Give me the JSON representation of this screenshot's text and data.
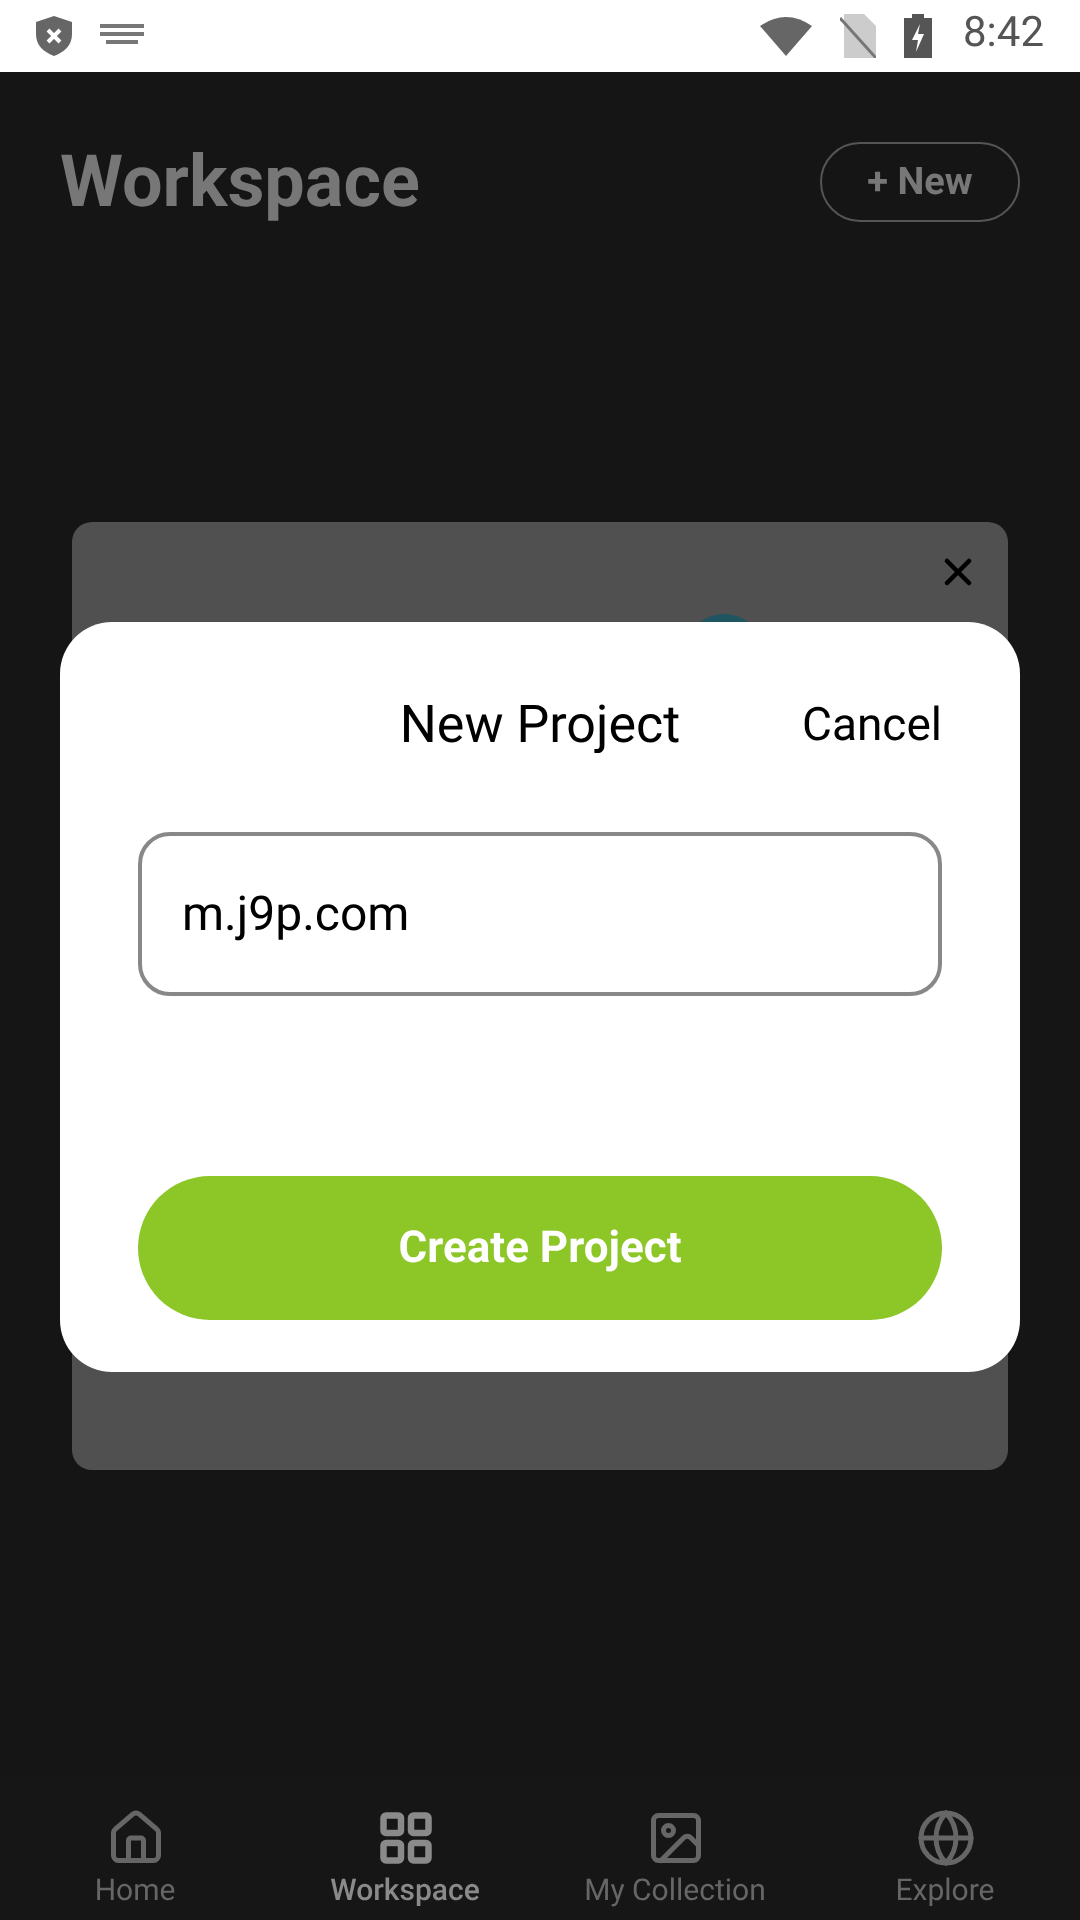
{
  "status_bar": {
    "time": "8:42"
  },
  "header": {
    "title": "Workspace",
    "new_button": "+ New"
  },
  "dialog": {
    "title": "New Project",
    "cancel": "Cancel",
    "name_field": {
      "value": "m.j9p.com"
    },
    "create_button": "Create Project"
  },
  "bottom_nav": [
    {
      "label": "Home",
      "selected": false
    },
    {
      "label": "Workspace",
      "selected": true
    },
    {
      "label": "My Collection",
      "selected": false
    },
    {
      "label": "Explore",
      "selected": false
    }
  ]
}
